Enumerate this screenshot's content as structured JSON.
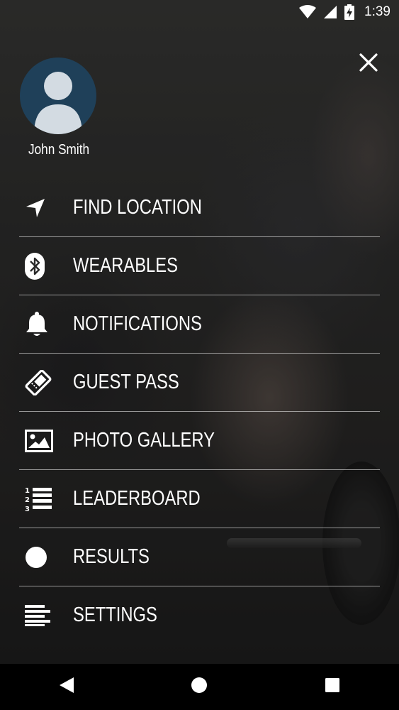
{
  "status_bar": {
    "time": "1:39",
    "icons": [
      "wifi-icon",
      "cellular-signal-icon",
      "battery-charging-icon"
    ]
  },
  "drawer": {
    "close_icon": "close-icon",
    "user": {
      "name": "John Smith",
      "avatar_icon": "person-icon",
      "avatar_color": "#1f4059"
    },
    "menu_items": [
      {
        "label": "FIND LOCATION",
        "icon": "location-arrow-icon"
      },
      {
        "label": "WEARABLES",
        "icon": "bluetooth-icon"
      },
      {
        "label": "NOTIFICATIONS",
        "icon": "bell-icon"
      },
      {
        "label": "GUEST PASS",
        "icon": "ticket-icon"
      },
      {
        "label": "PHOTO GALLERY",
        "icon": "image-icon"
      },
      {
        "label": "LEADERBOARD",
        "icon": "numbered-list-icon"
      },
      {
        "label": "RESULTS",
        "icon": "circle-icon"
      },
      {
        "label": "SETTINGS",
        "icon": "align-left-icon"
      }
    ]
  },
  "nav_bar": {
    "buttons": [
      "back-icon",
      "home-icon",
      "recents-icon"
    ]
  }
}
